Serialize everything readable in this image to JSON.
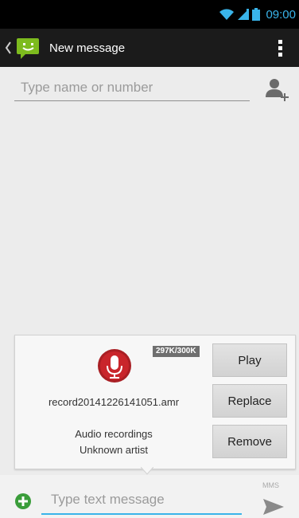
{
  "status_bar": {
    "time": "09:00",
    "icons": [
      "wifi-icon",
      "signal-icon",
      "battery-icon"
    ],
    "accent_color": "#39b4ea"
  },
  "action_bar": {
    "title": "New message",
    "icons": [
      "back-chevron-icon",
      "messaging-app-icon",
      "overflow-menu-icon"
    ]
  },
  "recipient": {
    "placeholder": "Type name or number",
    "add_contact_icon": "add-contact-icon"
  },
  "attachment": {
    "size_badge": "297K/300K",
    "icon": "microphone-icon",
    "file_name": "record20141226141051.amr",
    "album": "Audio recordings",
    "artist": "Unknown artist",
    "buttons": {
      "play": "Play",
      "replace": "Replace",
      "remove": "Remove"
    }
  },
  "compose": {
    "placeholder": "Type text message",
    "mms_label": "MMS",
    "add_icon": "add-attachment-icon",
    "send_icon": "send-icon",
    "accent_color": "#39b4ea",
    "add_icon_color": "#3a9d3a"
  }
}
